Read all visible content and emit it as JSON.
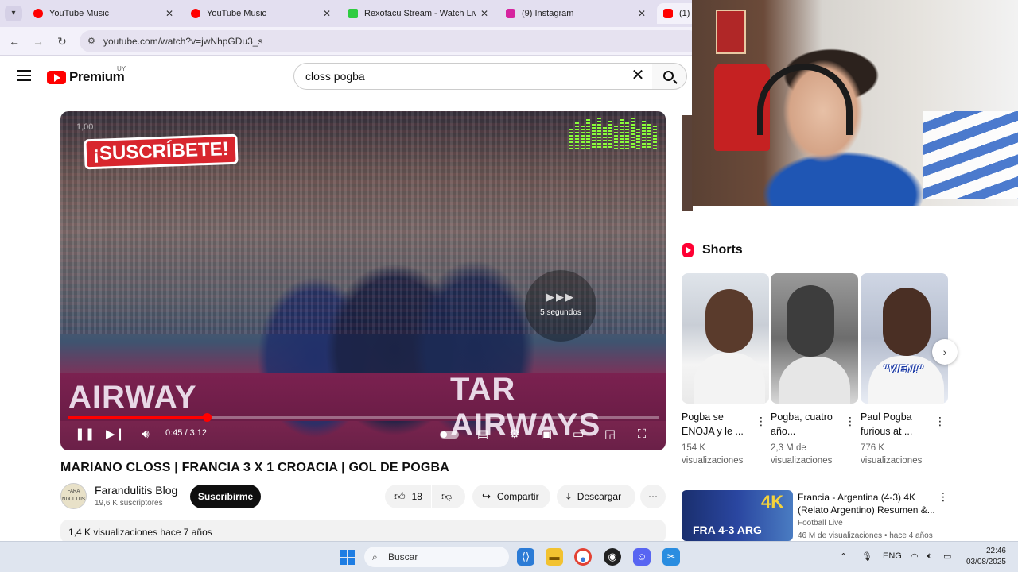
{
  "browser": {
    "tabs": [
      {
        "label": "YouTube Music",
        "favicon_color": "#ff0000"
      },
      {
        "label": "YouTube Music",
        "favicon_color": "#ff0000"
      },
      {
        "label": "Rexofacu Stream - Watch Live c",
        "favicon_color": "#2ecc40"
      },
      {
        "label": "(9) Instagram",
        "favicon_color": "#d6249f"
      },
      {
        "label": "(1)",
        "favicon_color": "#ff0000"
      }
    ],
    "url": "youtube.com/watch?v=jwNhpGDu3_s"
  },
  "youtube": {
    "logo_text": "Premium",
    "country_code": "UY",
    "search_query": "closs pogba"
  },
  "player": {
    "overlay_subscribe": "¡SUSCRÍBETE!",
    "overlay_corner": "1,00",
    "ad_board_text": "TAR AIRWAYS",
    "ad_board_text_left": "AIRWAY",
    "skip_label": "5 segundos",
    "time": "0:45 / 3:12",
    "progress_fraction": 0.234
  },
  "video": {
    "title": "MARIANO CLOSS | FRANCIA 3 X 1 CROACIA | GOL DE POGBA",
    "channel": {
      "name": "Farandulitis Blog",
      "subscribers": "19,6 K suscriptores",
      "avatar_text": "FARA NDUL ITIS"
    },
    "subscribe_label": "Suscribirme",
    "likes": "18",
    "share_label": "Compartir",
    "download_label": "Descargar",
    "description_meta": "1,4 K visualizaciones  hace 7 años"
  },
  "shorts": {
    "heading": "Shorts",
    "items": [
      {
        "title": "Pogba se ENOJA y le ...",
        "views": "154 K visualizaciones",
        "caption": ""
      },
      {
        "title": "Pogba, cuatro año...",
        "views": "2,3 M de visualizaciones",
        "caption": ""
      },
      {
        "title": "Paul Pogba furious at ...",
        "views": "776 K visualizaciones",
        "caption": "\"VIEN!\""
      }
    ]
  },
  "recommended": {
    "title": "Francia - Argentina (4-3) 4K (Relato Argentino) Resumen &...",
    "channel": "Football Live",
    "meta": "46 M de visualizaciones • hace 4 años",
    "thumb_badge": "4K",
    "thumb_score": "FRA 4-3 ARG"
  },
  "taskbar": {
    "search_placeholder": "Buscar",
    "language": "ENG",
    "time": "22:46",
    "date": "03/08/2025"
  }
}
